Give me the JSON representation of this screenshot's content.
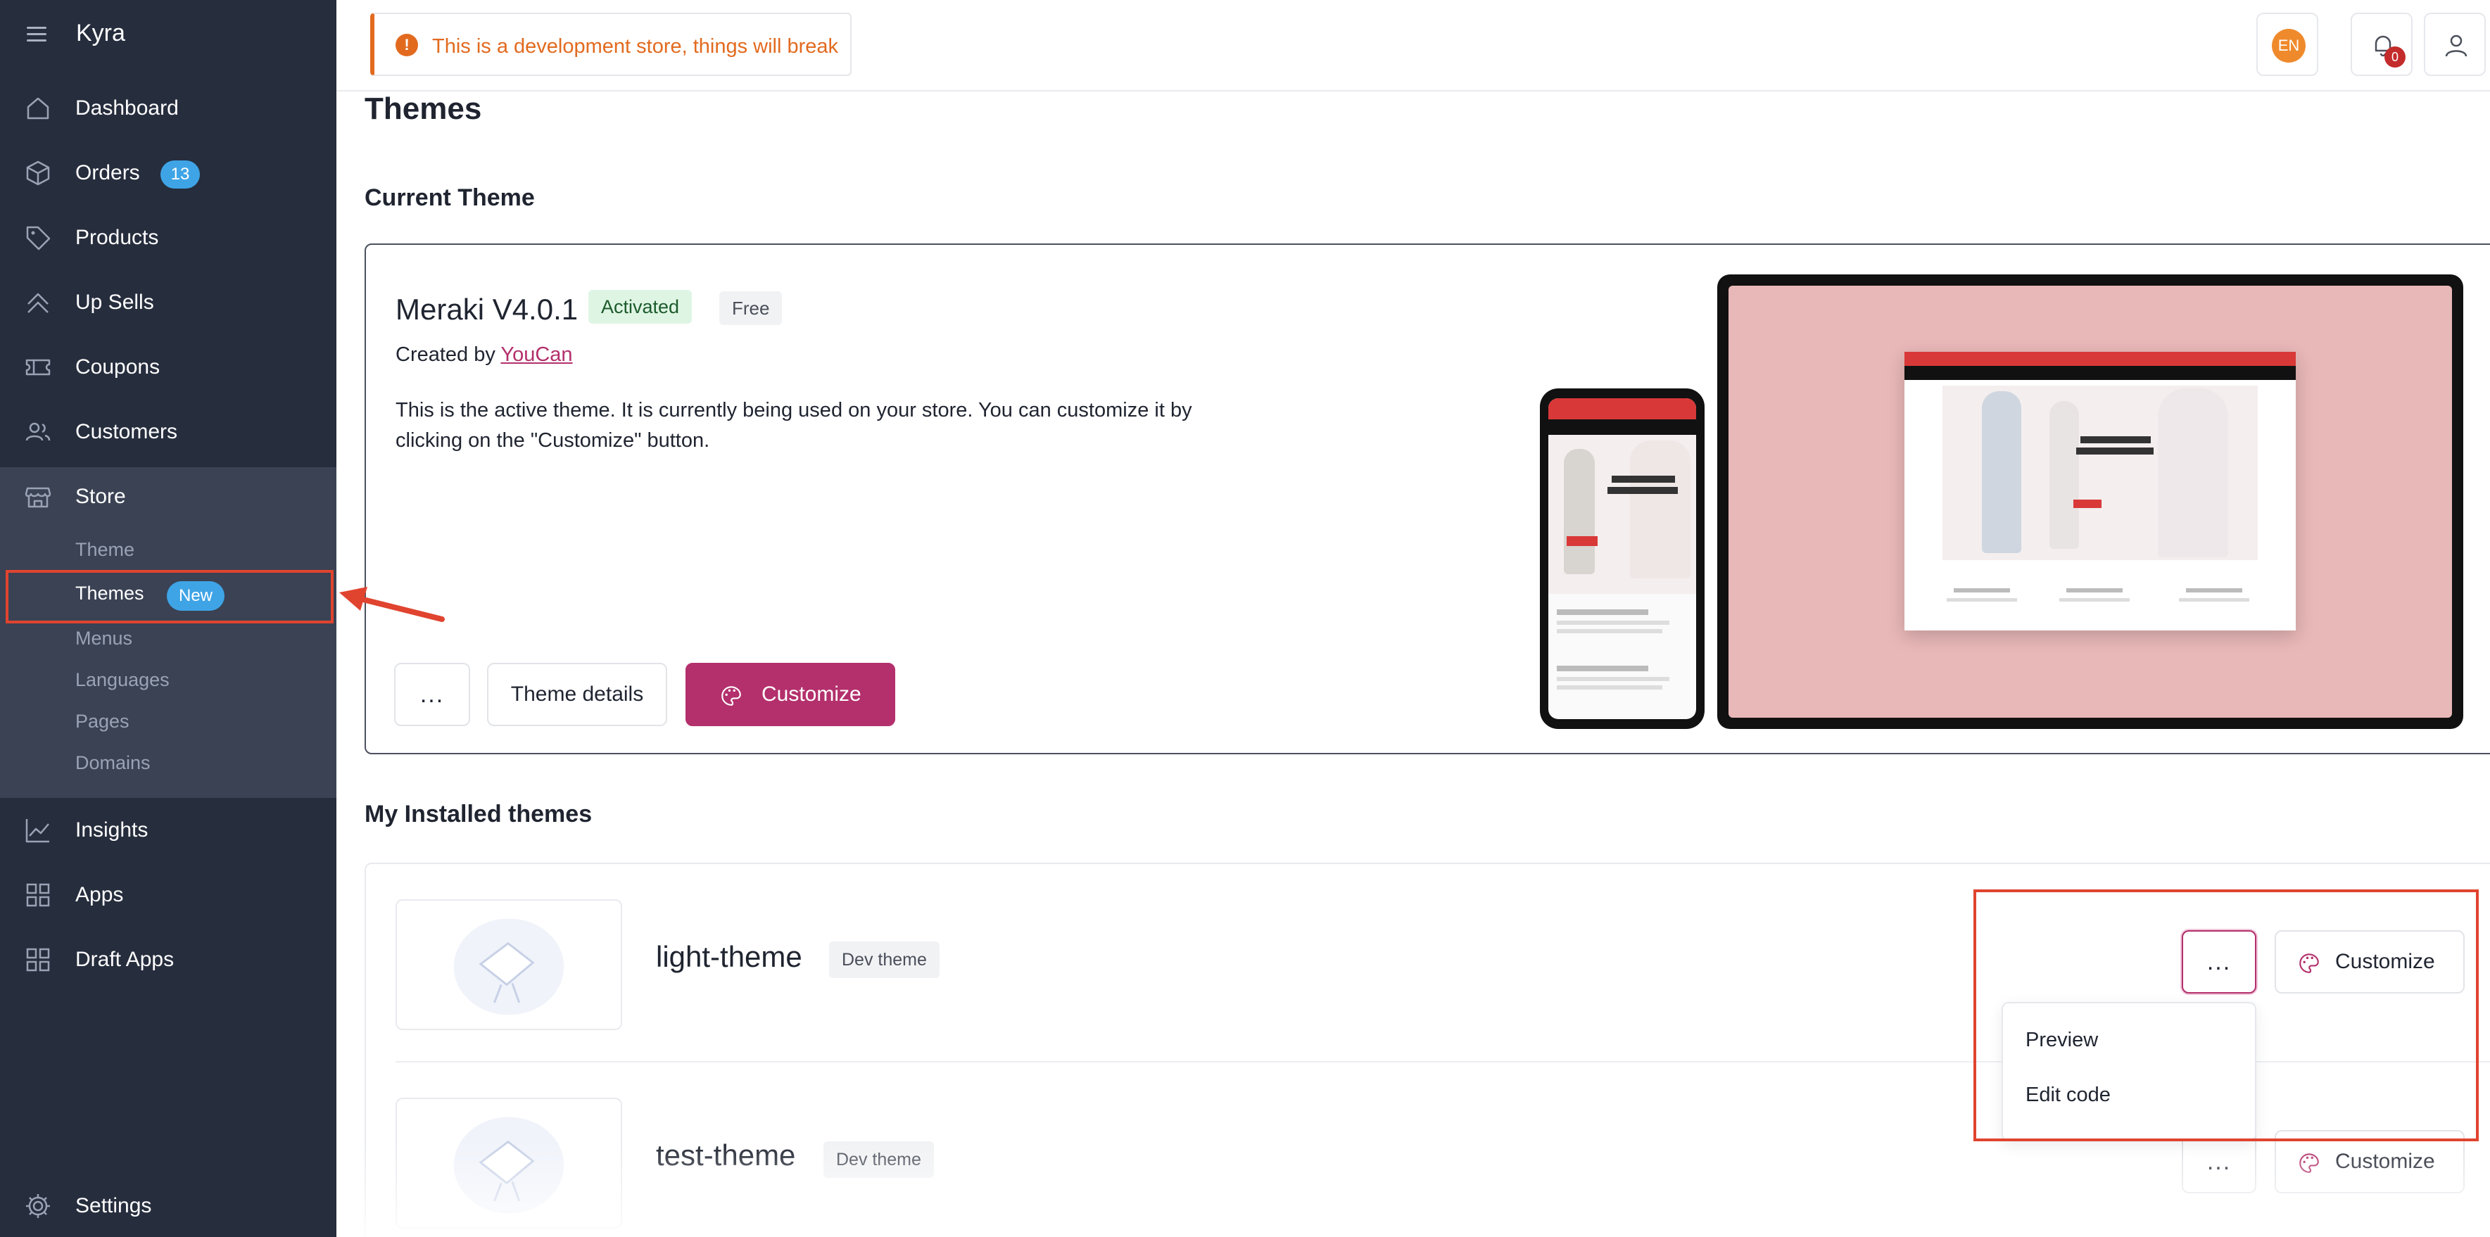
{
  "sidebar": {
    "brand": "Kyra",
    "nav": [
      {
        "label": "Dashboard",
        "icon": "home-icon"
      },
      {
        "label": "Orders",
        "icon": "box-icon",
        "badge": "13"
      },
      {
        "label": "Products",
        "icon": "tag-icon"
      },
      {
        "label": "Up Sells",
        "icon": "chevrons-up-icon"
      },
      {
        "label": "Coupons",
        "icon": "ticket-icon"
      },
      {
        "label": "Customers",
        "icon": "users-icon"
      },
      {
        "label": "Store",
        "icon": "store-icon"
      }
    ],
    "store_sub": [
      {
        "label": "Theme"
      },
      {
        "label": "Themes",
        "badge": "New"
      },
      {
        "label": "Menus"
      },
      {
        "label": "Languages"
      },
      {
        "label": "Pages"
      },
      {
        "label": "Domains"
      }
    ],
    "nav_bottom": [
      {
        "label": "Insights",
        "icon": "chart-line-icon"
      },
      {
        "label": "Apps",
        "icon": "grid-icon"
      },
      {
        "label": "Draft Apps",
        "icon": "grid-icon"
      }
    ],
    "settings_label": "Settings"
  },
  "topbar": {
    "alert_text": "This is a development store, things will break",
    "language": "EN",
    "notification_count": "0"
  },
  "main": {
    "title": "Themes",
    "current_section": "Current Theme",
    "current": {
      "name": "Meraki V4.0.1",
      "status": "Activated",
      "price": "Free",
      "created_by_prefix": "Created by",
      "author": "YouCan",
      "description": "This is the active theme. It is currently being used on your store. You can customize it by clicking on the \"Customize\" button.",
      "more_label": "...",
      "details_label": "Theme details",
      "customize_label": "Customize"
    },
    "installed_section": "My Installed themes",
    "installed": [
      {
        "name": "light-theme",
        "badge": "Dev theme",
        "more_label": "...",
        "customize_label": "Customize"
      },
      {
        "name": "test-theme",
        "badge": "Dev theme",
        "more_label": "...",
        "customize_label": "Customize"
      }
    ],
    "dropdown": {
      "preview": "Preview",
      "edit_code": "Edit code"
    }
  },
  "colors": {
    "sidebar_bg": "#262d3d",
    "store_bg": "#3a4254",
    "accent": "#b3306c",
    "badge_blue": "#3fa4e6",
    "alert_orange": "#e26a1f",
    "highlight_red": "#e0442f",
    "activated_green_bg": "#dff5e4"
  }
}
